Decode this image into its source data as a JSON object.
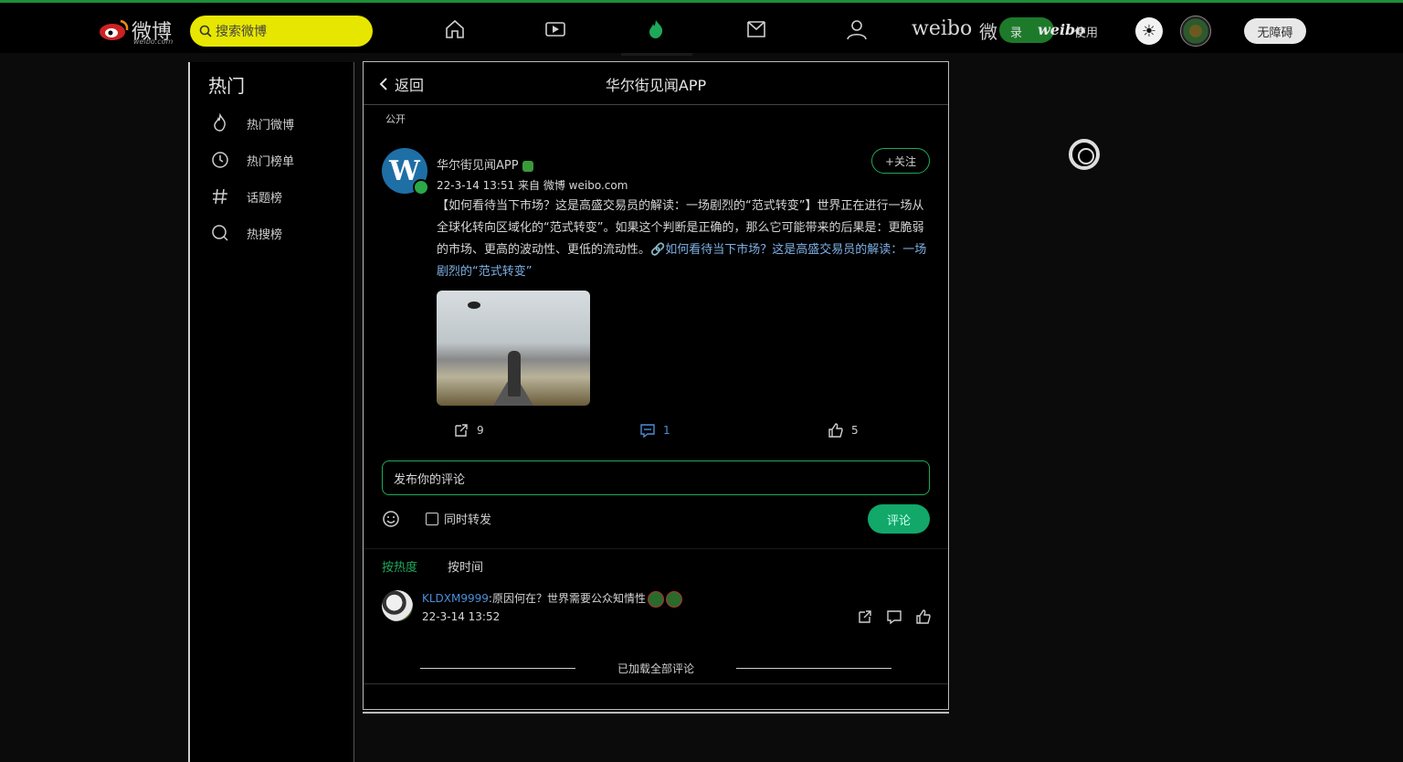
{
  "topbar": {
    "logo_text": "微博",
    "logo_sub": "weibo.com",
    "search_placeholder": "搜索微博",
    "nav_icons": [
      "home-icon",
      "video-icon",
      "hot-icon",
      "message-icon",
      "profile-icon"
    ],
    "banner": {
      "weibo": "weibo",
      "wei": "微",
      "register_hint": "录",
      "weibo_italic": "weibo",
      "suffix": "使用"
    },
    "accessibility_label": "无障碍"
  },
  "sidebar": {
    "title": "热门",
    "items": [
      {
        "label": "热门微博",
        "icon": "flame-icon"
      },
      {
        "label": "热门榜单",
        "icon": "clock-icon"
      },
      {
        "label": "话题榜",
        "icon": "hashtag-icon"
      },
      {
        "label": "热搜榜",
        "icon": "search-icon"
      }
    ]
  },
  "detail": {
    "back_label": "返回",
    "title": "华尔街见闻APP",
    "visibility": "公开",
    "post": {
      "author": "华尔街见闻APP",
      "avatar_letter": "W",
      "meta": "22-3-14 13:51  来自 微博 weibo.com",
      "follow_label": "+关注",
      "text": "【如何看待当下市场？这是高盛交易员的解读：一场剧烈的“范式转变”】世界正在进行一场从全球化转向区域化的“范式转变”。如果这个判断是正确的，那么它可能带来的后果是：更脆弱的市场、更高的波动性、更低的流动性。",
      "link_text": "🔗如何看待当下市场？这是高盛交易员的解读：一场剧烈的“范式转变”",
      "repost_count": "9",
      "comment_count": "1",
      "like_count": "5"
    },
    "comment_input_placeholder": "发布你的评论",
    "also_repost_label": "同时转发",
    "submit_label": "评论",
    "sort_tabs": [
      "按热度",
      "按时间"
    ],
    "comments": [
      {
        "user": "KLDXM9999",
        "text": ":原因何在？世界需要公众知情性",
        "time": "22-3-14 13:52"
      }
    ],
    "all_loaded": "已加载全部评论"
  },
  "colors": {
    "accent": "#1ea85a",
    "link": "#4a8fd8",
    "search_bg": "#e6e600"
  }
}
